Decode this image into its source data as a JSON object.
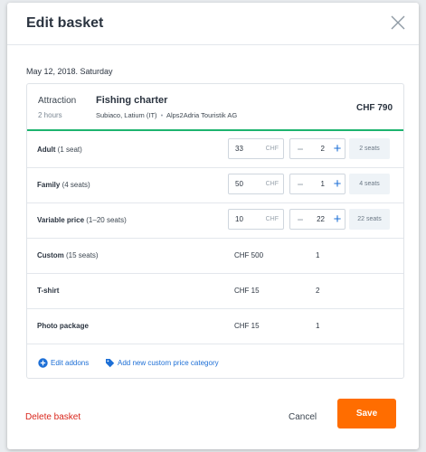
{
  "modal": {
    "title": "Edit basket",
    "date": "May 12, 2018. Saturday"
  },
  "attraction": {
    "label": "Attraction",
    "duration": "2 hours",
    "name": "Fishing charter",
    "location": "Subiaco, Latium (IT)",
    "separator": "•",
    "provider": "Alps2Adria Touristik AG",
    "price": "CHF 790"
  },
  "price_rows": [
    {
      "name": "Adult",
      "sub": "(1 seat)",
      "price": "33",
      "currency": "CHF",
      "minus": "−",
      "qty": "2",
      "plus": "+",
      "seats": "2 seats"
    },
    {
      "name": "Family",
      "sub": "(4 seats)",
      "price": "50",
      "currency": "CHF",
      "minus": "−",
      "qty": "1",
      "plus": "+",
      "seats": "4 seats"
    },
    {
      "name": "Variable price",
      "sub": "(1–20 seats)",
      "price": "10",
      "currency": "CHF",
      "minus": "−",
      "qty": "22",
      "plus": "+",
      "seats": "22 seats"
    }
  ],
  "static_rows": [
    {
      "name": "Custom",
      "sub": "(15 seats)",
      "price": "CHF 500",
      "qty": "1"
    },
    {
      "name": "T-shirt",
      "sub": "",
      "price": "CHF 15",
      "qty": "2"
    },
    {
      "name": "Photo package",
      "sub": "",
      "price": "CHF 15",
      "qty": "1"
    }
  ],
  "links": {
    "edit_addons": "Edit addons",
    "add_custom": "Add new custom price category"
  },
  "footer": {
    "delete": "Delete basket",
    "cancel": "Cancel",
    "save": "Save"
  },
  "colors": {
    "accent": "#1d6fd6",
    "save": "#ff6d00",
    "danger": "#d9261c",
    "divider_green": "#1db46f"
  },
  "icons": {
    "close": "close-icon",
    "edit_addons": "plus-circle-icon",
    "custom_price": "tag-icon"
  }
}
